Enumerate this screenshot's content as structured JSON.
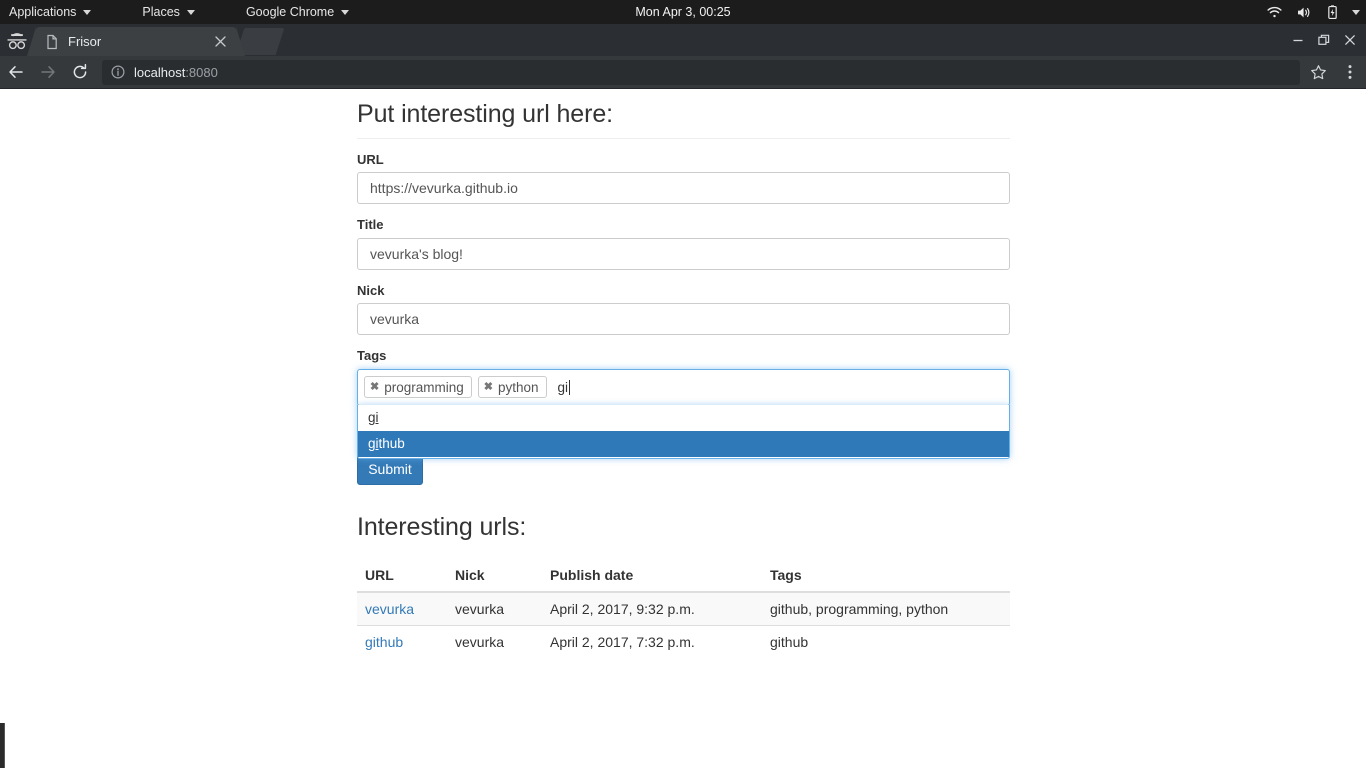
{
  "desktop": {
    "panel": {
      "menus": [
        {
          "label": "Applications",
          "icon": "chevron-down-icon"
        },
        {
          "label": "Places",
          "icon": "chevron-down-icon"
        },
        {
          "label": "Google Chrome",
          "icon": "chevron-down-icon"
        }
      ],
      "clock": "Mon Apr  3, 00:25",
      "tray": [
        "wifi-icon",
        "volume-icon",
        "battery-charging-icon",
        "chevron-down-icon"
      ],
      "bg_color": "#1c1c1c"
    }
  },
  "browser": {
    "incognito_icon": "incognito-icon",
    "tab": {
      "title": "Frisor",
      "favicon": "page-icon",
      "close_icon": "close-icon"
    },
    "window_controls": {
      "minimize": "minimize-icon",
      "restore": "restore-icon",
      "close": "close-icon"
    },
    "toolbar": {
      "back_icon": "back-arrow-icon",
      "forward_icon": "forward-arrow-icon",
      "reload_icon": "reload-icon",
      "info_icon": "info-circle-icon",
      "url_host": "localhost",
      "url_port": ":8080",
      "bookmark_icon": "star-icon",
      "menu_icon": "three-dot-menu-icon"
    }
  },
  "page": {
    "heading": "Put interesting url here:",
    "form": {
      "fields": [
        {
          "label": "URL",
          "value": "https://vevurka.github.io",
          "name": "url"
        },
        {
          "label": "Title",
          "value": "vevurka's blog!",
          "name": "title"
        },
        {
          "label": "Nick",
          "value": "vevurka",
          "name": "nick"
        }
      ],
      "tags": {
        "label": "Tags",
        "chips": [
          {
            "label": "programming",
            "remove_icon": "close-icon",
            "remove_glyph": "✖"
          },
          {
            "label": "python",
            "remove_icon": "close-icon",
            "remove_glyph": "✖"
          }
        ],
        "input_value": "gi",
        "suggestions": [
          {
            "match": "gi",
            "rest": "",
            "selected": false
          },
          {
            "match": "gi",
            "rest": "thub",
            "selected": true
          }
        ],
        "focus_color": "#66afe9",
        "selected_color": "#3079b8"
      },
      "submit_label": "Submit",
      "submit_color": "#337ab7"
    },
    "list": {
      "heading": "Interesting urls:",
      "columns": [
        "URL",
        "Nick",
        "Publish date",
        "Tags"
      ],
      "rows": [
        {
          "url": "vevurka",
          "nick": "vevurka",
          "date": "April 2, 2017, 9:32 p.m.",
          "tags": "github, programming, python"
        },
        {
          "url": "github",
          "nick": "vevurka",
          "date": "April 2, 2017, 7:32 p.m.",
          "tags": "github"
        }
      ],
      "link_color": "#337ab7"
    }
  }
}
